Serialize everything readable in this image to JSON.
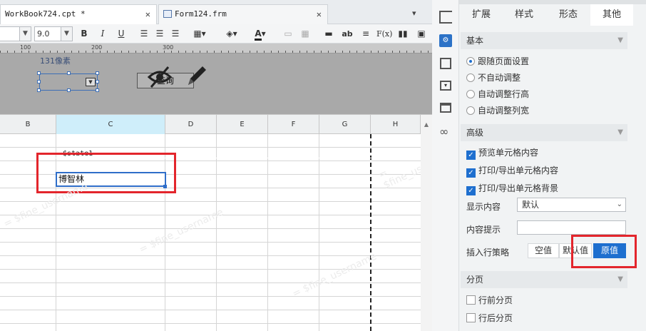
{
  "tabs": [
    {
      "label": "WorkBook724.cpt *",
      "active": true
    },
    {
      "label": "Form124.frm",
      "active": false
    }
  ],
  "toolbar": {
    "font_value": "",
    "size_value": "9.0",
    "bold": "B",
    "italic": "I",
    "underline": "U",
    "fx": "F(x)",
    "ab": "ab"
  },
  "ruler": {
    "ticks": [
      "100",
      "200",
      "300"
    ]
  },
  "form": {
    "widget_label": "131像素",
    "button_label": "查询"
  },
  "columns": [
    "B",
    "C",
    "D",
    "E",
    "F",
    "G",
    "H"
  ],
  "cells": {
    "c_formula": "$state1",
    "c_value": "博智林"
  },
  "watermark": "= $fine_username",
  "panel": {
    "tabs": [
      "扩展",
      "样式",
      "形态",
      "其他"
    ],
    "active_tab": "其他",
    "basic": {
      "title": "基本",
      "options": [
        "跟随页面设置",
        "不自动调整",
        "自动调整行高",
        "自动调整列宽"
      ],
      "selected": "跟随页面设置"
    },
    "advanced": {
      "title": "高级",
      "checks": [
        "预览单元格内容",
        "打印/导出单元格内容",
        "打印/导出单元格背景"
      ],
      "display_label": "显示内容",
      "display_value": "默认",
      "hint_label": "内容提示",
      "hint_value": "",
      "insert_label": "插入行策略",
      "insert_options": [
        "空值",
        "默认值",
        "原值"
      ],
      "insert_selected": "原值"
    },
    "paging": {
      "title": "分页",
      "checks": [
        "行前分页",
        "行后分页"
      ]
    }
  },
  "colors": {
    "accent": "#1e6fcf",
    "highlight": "#e3252c",
    "selected_column": "#cfeefa"
  }
}
